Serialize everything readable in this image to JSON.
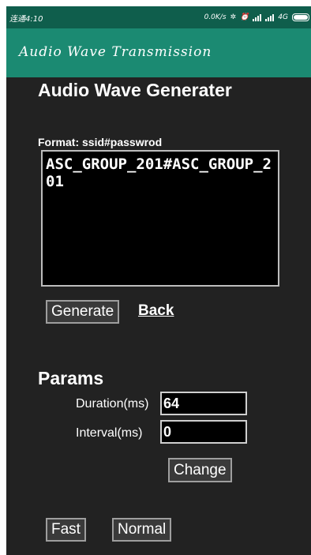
{
  "status_bar": {
    "carrier": "连通4:10",
    "speed": "0.0K/s",
    "signal_label": "4G"
  },
  "app_bar": {
    "title": "Audio Wave Transmission"
  },
  "generator": {
    "heading": "Audio Wave Generater",
    "format_label": "Format: ssid#passwrod",
    "ssid_value": "ASC_GROUP_201#ASC_GROUP_201",
    "generate_label": "Generate",
    "back_label": "Back"
  },
  "params": {
    "heading": "Params",
    "duration_label": "Duration(ms)",
    "duration_value": "64",
    "interval_label": "Interval(ms)",
    "interval_value": "0",
    "change_label": "Change"
  },
  "mode_buttons": {
    "fast_label": "Fast",
    "normal_label": "Normal"
  },
  "colors": {
    "status_bar": "#0f5e4c",
    "app_bar": "#1b8a72",
    "background": "#222222"
  }
}
